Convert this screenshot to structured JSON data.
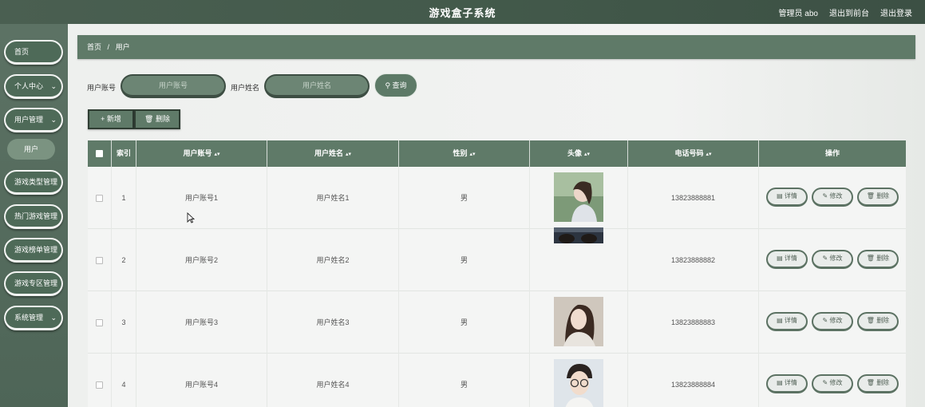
{
  "header": {
    "title": "游戏盒子系统",
    "admin": "管理员 abo",
    "to_front": "退出到前台",
    "logout": "退出登录"
  },
  "sidebar": {
    "items": [
      {
        "label": "首页",
        "chevron": false
      },
      {
        "label": "个人中心",
        "chevron": true
      },
      {
        "label": "用户管理",
        "chevron": true
      },
      {
        "label": "游戏类型管理",
        "chevron": true
      },
      {
        "label": "热门游戏管理",
        "chevron": true
      },
      {
        "label": "游戏榜单管理",
        "chevron": true
      },
      {
        "label": "游戏专区管理",
        "chevron": true
      },
      {
        "label": "系统管理",
        "chevron": true
      }
    ],
    "sub_item": "用户"
  },
  "breadcrumb": {
    "home": "首页",
    "sep": "/",
    "current": "用户"
  },
  "search": {
    "account_label": "用户账号",
    "account_placeholder": "用户账号",
    "name_label": "用户姓名",
    "name_placeholder": "用户姓名",
    "query_button": "查询"
  },
  "actions": {
    "add": "新增",
    "delete": "删除"
  },
  "table": {
    "headers": [
      "索引",
      "用户账号",
      "用户姓名",
      "性别",
      "头像",
      "电话号码",
      "操作"
    ],
    "rows": [
      {
        "index": "1",
        "account": "用户账号1",
        "name": "用户姓名1",
        "gender": "男",
        "phone": "13823888881"
      },
      {
        "index": "2",
        "account": "用户账号2",
        "name": "用户姓名2",
        "gender": "男",
        "phone": "13823888882"
      },
      {
        "index": "3",
        "account": "用户账号3",
        "name": "用户姓名3",
        "gender": "男",
        "phone": "13823888883"
      },
      {
        "index": "4",
        "account": "用户账号4",
        "name": "用户姓名4",
        "gender": "男",
        "phone": "13823888884"
      }
    ],
    "op_labels": {
      "detail": "详情",
      "edit": "修改",
      "delete": "删除"
    }
  },
  "colors": {
    "primary": "#5f7a68",
    "header_bg": "#435a4b",
    "sidebar_bg": "#56695c",
    "page_bg": "#eef0ee"
  }
}
